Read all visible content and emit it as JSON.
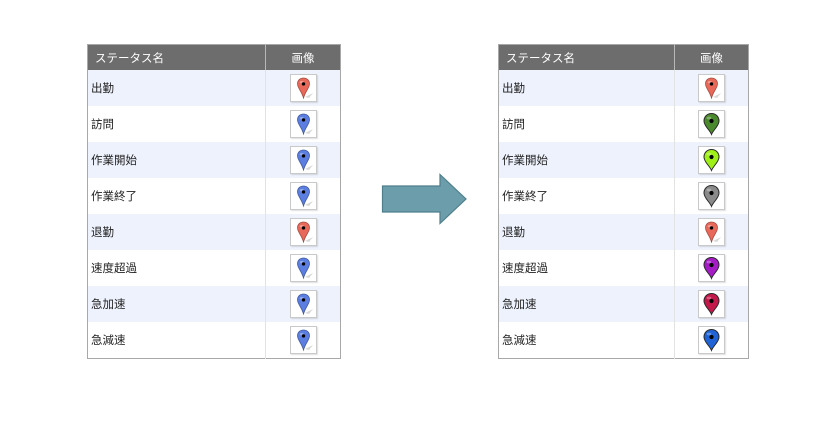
{
  "tables": [
    {
      "header": {
        "name": "ステータス名",
        "image": "画像"
      },
      "rows": [
        {
          "label": "出勤",
          "marker": {
            "icon": "map-pin-icon",
            "style": "classic",
            "color": "#e8695a"
          }
        },
        {
          "label": "訪問",
          "marker": {
            "icon": "map-pin-icon",
            "style": "classic",
            "color": "#5b7ee0"
          }
        },
        {
          "label": "作業開始",
          "marker": {
            "icon": "map-pin-icon",
            "style": "classic",
            "color": "#5b7ee0"
          }
        },
        {
          "label": "作業終了",
          "marker": {
            "icon": "map-pin-icon",
            "style": "classic",
            "color": "#5b7ee0"
          }
        },
        {
          "label": "退勤",
          "marker": {
            "icon": "map-pin-icon",
            "style": "classic",
            "color": "#e8695a"
          }
        },
        {
          "label": "速度超過",
          "marker": {
            "icon": "map-pin-icon",
            "style": "classic",
            "color": "#5b7ee0"
          }
        },
        {
          "label": "急加速",
          "marker": {
            "icon": "map-pin-icon",
            "style": "classic",
            "color": "#5b7ee0"
          }
        },
        {
          "label": "急減速",
          "marker": {
            "icon": "map-pin-icon",
            "style": "classic",
            "color": "#5b7ee0"
          }
        }
      ]
    },
    {
      "header": {
        "name": "ステータス名",
        "image": "画像"
      },
      "rows": [
        {
          "label": "出勤",
          "marker": {
            "icon": "map-pin-icon",
            "style": "classic",
            "color": "#e8695a"
          }
        },
        {
          "label": "訪問",
          "marker": {
            "icon": "map-pin-icon",
            "style": "round",
            "color": "#4a8a2c"
          }
        },
        {
          "label": "作業開始",
          "marker": {
            "icon": "map-pin-icon",
            "style": "round",
            "color": "#9ef016"
          }
        },
        {
          "label": "作業終了",
          "marker": {
            "icon": "map-pin-icon",
            "style": "round",
            "color": "#8a8a8a"
          }
        },
        {
          "label": "退勤",
          "marker": {
            "icon": "map-pin-icon",
            "style": "classic",
            "color": "#e8695a"
          }
        },
        {
          "label": "速度超過",
          "marker": {
            "icon": "map-pin-icon",
            "style": "round",
            "color": "#a51cc6"
          }
        },
        {
          "label": "急加速",
          "marker": {
            "icon": "map-pin-icon",
            "style": "round",
            "color": "#c3184a"
          }
        },
        {
          "label": "急減速",
          "marker": {
            "icon": "map-pin-icon",
            "style": "round",
            "color": "#1f63d6"
          }
        }
      ]
    }
  ],
  "arrow": {
    "icon": "right-arrow-icon",
    "fill": "#6b9dab",
    "stroke": "#4f7f8c"
  }
}
